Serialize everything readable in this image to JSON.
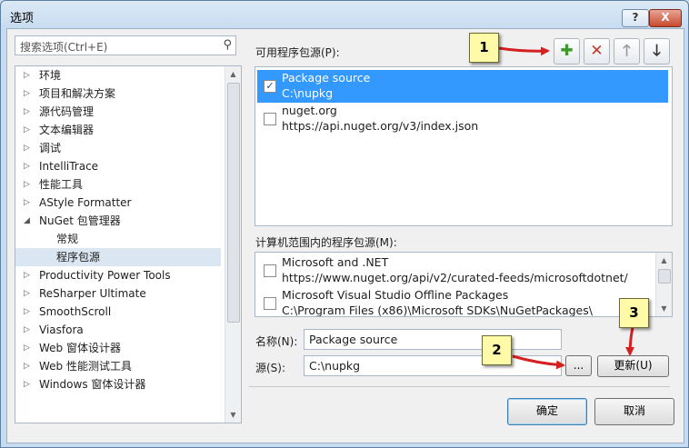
{
  "window": {
    "title": "选项",
    "help_label": "?",
    "close_label": "X"
  },
  "search": {
    "placeholder": "搜索选项(Ctrl+E)"
  },
  "tree": {
    "items": [
      {
        "label": "环境"
      },
      {
        "label": "项目和解决方案"
      },
      {
        "label": "源代码管理"
      },
      {
        "label": "文本编辑器"
      },
      {
        "label": "调试"
      },
      {
        "label": "IntelliTrace"
      },
      {
        "label": "性能工具"
      },
      {
        "label": "AStyle Formatter"
      },
      {
        "label": "NuGet 包管理器"
      },
      {
        "label": "常规"
      },
      {
        "label": "程序包源"
      },
      {
        "label": "Productivity Power Tools"
      },
      {
        "label": "ReSharper Ultimate"
      },
      {
        "label": "SmoothScroll"
      },
      {
        "label": "Viasfora"
      },
      {
        "label": "Web 窗体设计器"
      },
      {
        "label": "Web 性能测试工具"
      },
      {
        "label": "Windows 窗体设计器"
      }
    ]
  },
  "available": {
    "label": "可用程序包源(P):",
    "sources": [
      {
        "name": "Package source",
        "url": "C:\\nupkg",
        "checked": true
      },
      {
        "name": "nuget.org",
        "url": "https://api.nuget.org/v3/index.json",
        "checked": false
      }
    ]
  },
  "machine": {
    "label": "计算机范围内的程序包源(M):",
    "sources": [
      {
        "name": "Microsoft and .NET",
        "url": "https://www.nuget.org/api/v2/curated-feeds/microsoftdotnet/",
        "checked": false
      },
      {
        "name": "Microsoft Visual Studio Offline Packages",
        "url": "C:\\Program Files (x86)\\Microsoft SDKs\\NuGetPackages\\",
        "checked": false
      }
    ]
  },
  "form": {
    "name_label": "名称(N):",
    "name_value": "Package source",
    "source_label": "源(S):",
    "source_value": "C:\\nupkg",
    "browse_label": "...",
    "update_label": "更新(U)"
  },
  "toolbar": {
    "add_icon": "plus-icon",
    "remove_icon": "x-icon",
    "up_icon": "arrow-up-icon",
    "down_icon": "arrow-down-icon",
    "add_glyph": "✚",
    "remove_glyph": "✕",
    "up_glyph": "🡑",
    "down_glyph": "🡓"
  },
  "buttons": {
    "ok": "确定",
    "cancel": "取消"
  },
  "callouts": [
    "1",
    "2",
    "3"
  ],
  "colors": {
    "selection": "#3399ff",
    "add": "#3c9a2a",
    "remove": "#c0392b",
    "callout": "#fffaa8",
    "arrow": "#d42020"
  }
}
